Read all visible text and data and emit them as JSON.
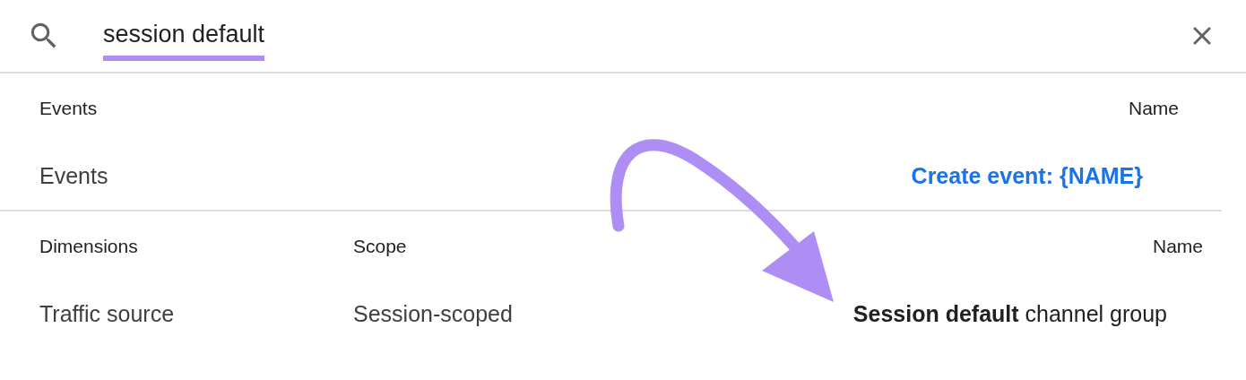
{
  "search": {
    "value": "session default"
  },
  "sections": [
    {
      "headers": {
        "first": "Events",
        "name": "Name"
      },
      "rows": [
        {
          "label": "Events",
          "name": "Create event: {NAME}",
          "kind": "link"
        }
      ]
    },
    {
      "headers": {
        "first": "Dimensions",
        "scope": "Scope",
        "name": "Name"
      },
      "rows": [
        {
          "label": "Traffic source",
          "scope": "Session-scoped",
          "name": "**Session default** channel group",
          "kind": "text"
        }
      ]
    }
  ]
}
